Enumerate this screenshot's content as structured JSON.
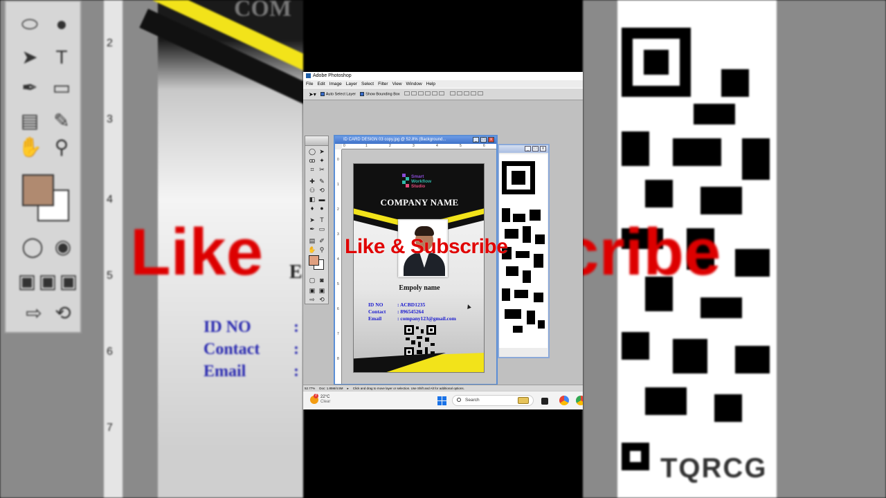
{
  "window": {
    "title": "Adobe Photoshop"
  },
  "menu": [
    "File",
    "Edit",
    "Image",
    "Layer",
    "Select",
    "Filter",
    "View",
    "Window",
    "Help"
  ],
  "options": {
    "auto_select": "Auto Select Layer",
    "show_bounding": "Show Bounding Box"
  },
  "document": {
    "title": "ID CARD DESIGN 03 copy.jpg @ 52.8% (Background..."
  },
  "ruler_top": [
    "0",
    "1",
    "2",
    "3",
    "4",
    "5",
    "6"
  ],
  "ruler_left": [
    "0",
    "1",
    "2",
    "3",
    "4",
    "5",
    "6",
    "7",
    "8"
  ],
  "card": {
    "logo_lines": [
      "Smart",
      "Workflow",
      "Studio"
    ],
    "company_name": "COMPANY NAME",
    "employee_name": "Empoly name",
    "info": [
      {
        "key": "ID NO",
        "value": ": ACBD1235"
      },
      {
        "key": "Contact",
        "value": ": 896545264"
      },
      {
        "key": "Email",
        "value": ": company123@gmail.com"
      }
    ]
  },
  "qr_label": "TQRCG",
  "statusbar": {
    "zoom": "52.77%",
    "doc": "Doc: 1.85M/4.5M",
    "hint": "Click and drag to move layer or selection.  Use Shift and Alt for additional options."
  },
  "taskbar": {
    "temp": "22°C",
    "condition": "Clear",
    "badge": "7",
    "search_placeholder": "Search"
  },
  "overlay": "Like & Subscribe",
  "background": {
    "ghost_company": "COM",
    "ghost_e": "E",
    "ghost_id": "ID NO",
    "ghost_contact": "Contact",
    "ghost_email": "Email",
    "ghost_colon": ":",
    "like_left": "Like",
    "like_right": "cribe",
    "ruler_nums": [
      "2",
      "3",
      "4",
      "5",
      "6",
      "7"
    ]
  },
  "colors": {
    "card_yellow": "#f2e31a",
    "overlay_red": "#e00000",
    "info_blue": "#1a1acf",
    "ps_title_blue": "#3f72c9"
  }
}
